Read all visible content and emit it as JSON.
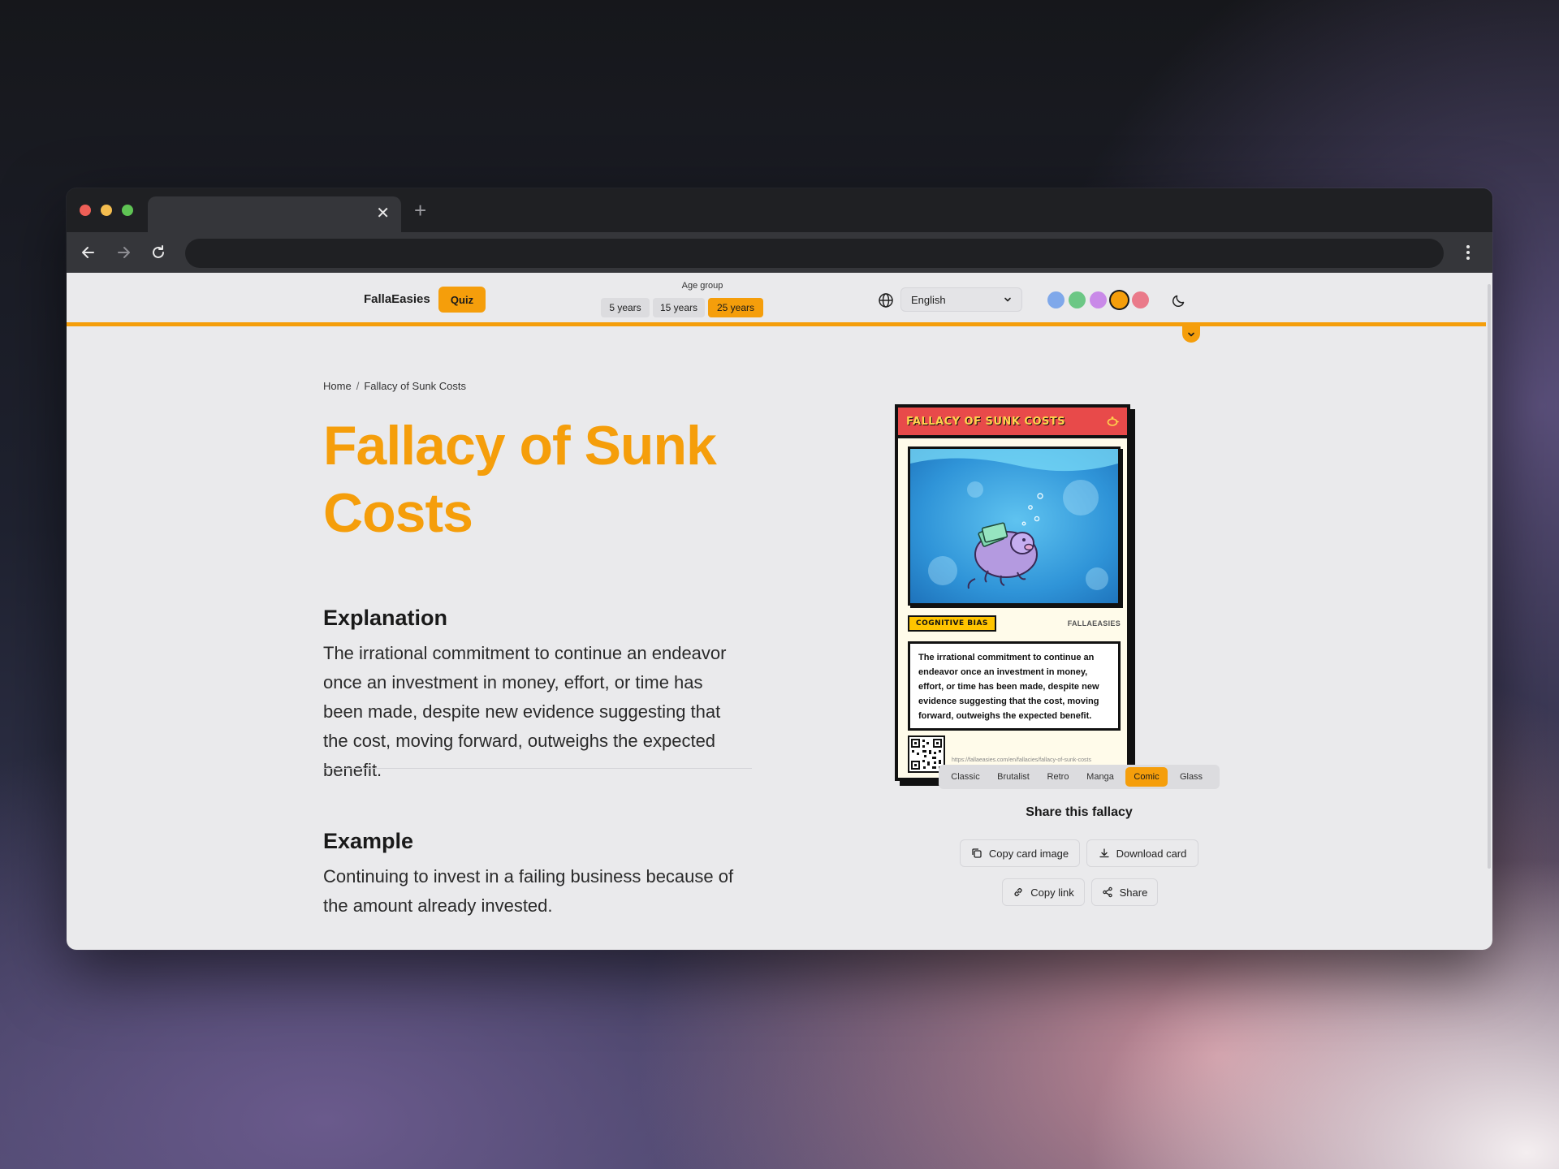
{
  "browser": {
    "tab_close": "✕",
    "new_tab": "+"
  },
  "header": {
    "brand": "FallaEasies",
    "quiz_label": "Quiz",
    "age_group_label": "Age group",
    "age_options": [
      "5 years",
      "15 years",
      "25 years"
    ],
    "age_selected": "25 years",
    "language": "English",
    "theme_colors": [
      "#7fa8ea",
      "#6cc785",
      "#c98ae8",
      "#f59e0b",
      "#ea7a8a"
    ],
    "theme_selected": "#f59e0b",
    "accent_color": "#f59e0b"
  },
  "breadcrumb": {
    "home": "Home",
    "separator": "/",
    "current": "Fallacy of Sunk Costs"
  },
  "main": {
    "title": "Fallacy of Sunk Costs",
    "explanation_heading": "Explanation",
    "explanation_text": "The irrational commitment to continue an endeavor once an investment in money, effort, or time has been made, despite new evidence suggesting that the cost, moving forward, outweighs the expected benefit.",
    "example_heading": "Example",
    "example_text": "Continuing to invest in a failing business because of the amount already invested."
  },
  "card": {
    "title": "FALLACY OF SUNK COSTS",
    "tag": "COGNITIVE BIAS",
    "brand": "FALLAEASIES",
    "description": "The irrational commitment to continue an endeavor once an investment in money, effort, or time has been made, despite new evidence suggesting that the cost, moving forward, outweighs the expected benefit.",
    "url": "https://fallaeasies.com/en/fallacies/fallacy-of-sunk-costs",
    "head_color": "#e84a4a",
    "tag_color": "#ffc400"
  },
  "styles": {
    "options": [
      "Classic",
      "Brutalist",
      "Retro",
      "Manga",
      "Comic",
      "Glass"
    ],
    "selected": "Comic"
  },
  "share": {
    "title": "Share this fallacy",
    "copy_image": "Copy card image",
    "download": "Download card",
    "copy_link": "Copy link",
    "share": "Share"
  }
}
